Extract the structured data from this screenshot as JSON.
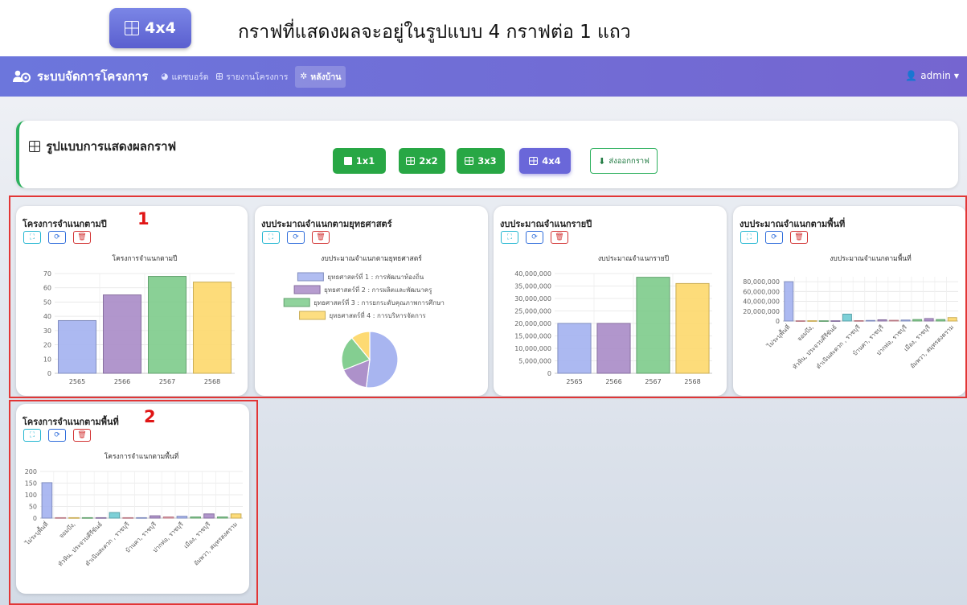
{
  "caption": {
    "badge_label": "4x4",
    "text": "กราฟที่แสดงผลจะอยู่ในรูปแบบ 4 กราฟต่อ 1 แถว"
  },
  "navbar": {
    "brand": "ระบบจัดการโครงการ",
    "items": [
      {
        "label": "แดชบอร์ด",
        "icon": "dashboard-icon"
      },
      {
        "label": "รายงานโครงการ",
        "icon": "table-icon"
      },
      {
        "label": "หลังบ้าน",
        "icon": "gear-icon",
        "active": true
      }
    ],
    "user": "admin"
  },
  "settings": {
    "title": "รูปแบบการแสดงผลกราฟ",
    "layout_buttons": [
      {
        "label": "1x1",
        "color": "#28a745"
      },
      {
        "label": "2x2",
        "color": "#28a745"
      },
      {
        "label": "3x3",
        "color": "#28a745"
      },
      {
        "label": "4x4",
        "color": "#6a67d9",
        "selected": true
      }
    ],
    "export_label": "ส่งออกกราฟ"
  },
  "annotations": {
    "marker_1": "1",
    "marker_2": "2",
    "outline_color": "#e23636"
  },
  "colors": {
    "blue": "#a3b1ef",
    "purple": "#a98bc7",
    "green": "#7dcb8b",
    "yellow": "#fdd86b",
    "teal": "#6fcbd3",
    "red": "#e89aa8"
  },
  "cards": [
    {
      "title": "โครงการจำแนกตามปี",
      "chart_data": {
        "type": "bar",
        "title": "โครงการจำแนกตามปี",
        "categories": [
          "2565",
          "2566",
          "2567",
          "2568"
        ],
        "values": [
          37,
          55,
          68,
          64
        ],
        "ylim": [
          0,
          70
        ],
        "yticks": [
          0,
          10,
          20,
          30,
          40,
          50,
          60,
          70
        ],
        "ytick_labels": [
          "0",
          "10",
          "20",
          "30",
          "40",
          "50",
          "60",
          "70"
        ],
        "bar_colors": [
          "#a3b1ef",
          "#a98bc7",
          "#7dcb8b",
          "#fdd86b"
        ],
        "grid": true
      }
    },
    {
      "title": "งบประมาณจำแนกตามยุทธศาสตร์",
      "chart_data": {
        "type": "pie",
        "title": "งบประมาณจำแนกตามยุทธศาสตร์",
        "labels": [
          "ยุทธศาสตร์ที่ 1 : การพัฒนาท้องถิ่น",
          "ยุทธศาสตร์ที่ 2 : การผลิตและพัฒนาครู",
          "ยุทธศาสตร์ที่ 3 : การยกระดับคุณภาพการศึกษา",
          "ยุทธศาสตร์ที่ 4 : การบริหารจัดการ"
        ],
        "values": [
          52,
          17,
          20,
          11
        ],
        "slice_colors": [
          "#a3b1ef",
          "#a98bc7",
          "#7dcb8b",
          "#fdd86b"
        ],
        "legend": "top"
      }
    },
    {
      "title": "งบประมาณจำแนกรายปี",
      "chart_data": {
        "type": "bar",
        "title": "งบประมาณจำแนกรายปี",
        "categories": [
          "2565",
          "2566",
          "2567",
          "2568"
        ],
        "values": [
          20000000,
          20000000,
          38500000,
          36000000
        ],
        "ylim": [
          0,
          40000000
        ],
        "yticks": [
          0,
          5000000,
          10000000,
          15000000,
          20000000,
          25000000,
          30000000,
          35000000,
          40000000
        ],
        "ytick_labels": [
          "0",
          "5,000,000",
          "10,000,000",
          "15,000,000",
          "20,000,000",
          "25,000,000",
          "30,000,000",
          "35,000,000",
          "40,000,000"
        ],
        "bar_colors": [
          "#a3b1ef",
          "#a98bc7",
          "#7dcb8b",
          "#fdd86b"
        ],
        "grid": true
      }
    },
    {
      "title": "งบประมาณจำแนกตามพื้นที่",
      "chart_data": {
        "type": "bar",
        "title": "งบประมาณจำแนกตามพื้นที่",
        "categories": [
          "ไม่ระบุพื้นที่",
          "",
          "จอมบึง,",
          "",
          "หัวหิน, ประจวบคีรีขันธ์",
          "",
          "ดำเนินสะดวก , ราชบุรี",
          "",
          "บ้านคา, ราชบุรี",
          "",
          "ปากท่อ, ราชบุรี",
          "",
          "เมือง, ราชบุรี",
          "",
          "อัมพวา, สมุทรสงคราม"
        ],
        "values": [
          80000000,
          500000,
          600000,
          500000,
          500000,
          14000000,
          800000,
          1200000,
          2500000,
          1500000,
          2000000,
          3000000,
          5000000,
          3000000,
          7000000
        ],
        "ylim": [
          0,
          90000000
        ],
        "yticks": [
          0,
          20000000,
          40000000,
          60000000,
          80000000
        ],
        "ytick_labels": [
          "0",
          "20,000,000",
          "40,000,000",
          "60,000,000",
          "80,000,000"
        ],
        "bar_colors": [
          "#a3b1ef",
          "#e89aa8",
          "#fdd86b",
          "#7dcb8b",
          "#a98bc7",
          "#6fcbd3",
          "#e89aa8",
          "#a3b1ef",
          "#a98bc7",
          "#e89aa8",
          "#a3b1ef",
          "#7dcb8b",
          "#a98bc7",
          "#7dcb8b",
          "#fdd86b"
        ],
        "grid": true
      }
    },
    {
      "title": "โครงการจำแนกตามพื้นที่",
      "chart_data": {
        "type": "bar",
        "title": "โครงการจำแนกตามพื้นที่",
        "categories": [
          "ไม่ระบุพื้นที่",
          "",
          "จอมบึง,",
          "",
          "หัวหิน, ประจวบคีรีขันธ์",
          "",
          "ดำเนินสะดวก , ราชบุรี",
          "",
          "บ้านคา, ราชบุรี",
          "",
          "ปากท่อ, ราชบุรี",
          "",
          "เมือง, ราชบุรี",
          "",
          "อัมพวา, สมุทรสงคราม"
        ],
        "values": [
          152,
          2,
          2,
          2,
          2,
          24,
          2,
          2,
          10,
          5,
          8,
          5,
          18,
          5,
          18
        ],
        "ylim": [
          0,
          200
        ],
        "yticks": [
          0,
          50,
          100,
          150,
          200
        ],
        "ytick_labels": [
          "0",
          "50",
          "100",
          "150",
          "200"
        ],
        "bar_colors": [
          "#a3b1ef",
          "#e89aa8",
          "#fdd86b",
          "#7dcb8b",
          "#a98bc7",
          "#6fcbd3",
          "#e89aa8",
          "#a3b1ef",
          "#a98bc7",
          "#e89aa8",
          "#a3b1ef",
          "#7dcb8b",
          "#a98bc7",
          "#7dcb8b",
          "#fdd86b"
        ],
        "grid": true
      }
    }
  ]
}
